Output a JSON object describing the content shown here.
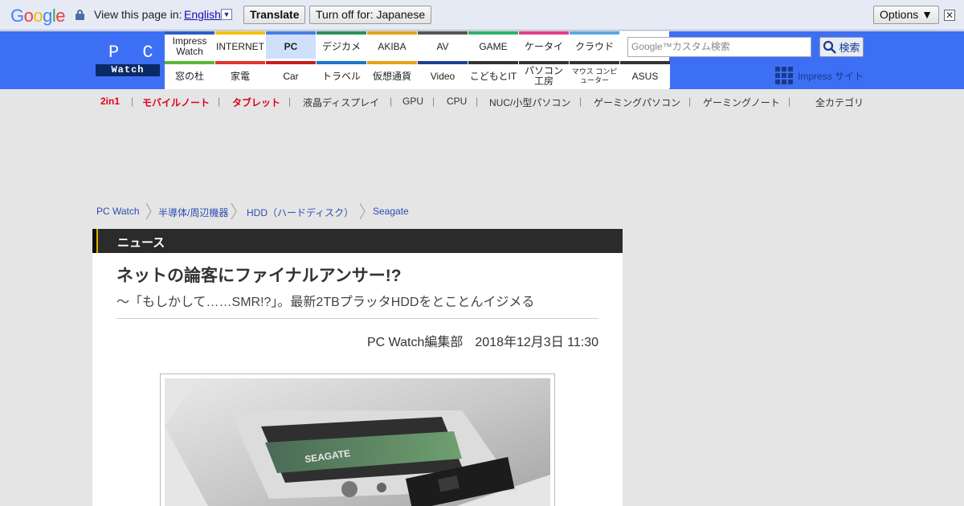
{
  "translate_bar": {
    "view_text": "View this page in:",
    "language": "English",
    "translate_label": "Translate",
    "turn_off_label": "Turn off for: Japanese",
    "options_label": "Options ▼",
    "close_symbol": "✕"
  },
  "header": {
    "logo_top": "P C",
    "logo_bottom": "Watch",
    "nav_top": [
      "Impress Watch",
      "INTERNET",
      "PC",
      "デジカメ",
      "AKIBA",
      "AV",
      "GAME",
      "ケータイ",
      "クラウド"
    ],
    "nav_bottom": [
      "窓の杜",
      "家電",
      "Car",
      "トラベル",
      "仮想通貨",
      "Video",
      "こどもとIT",
      "パソコン 工房",
      "マウス コンピューター",
      "ASUS"
    ],
    "nav_top_colors": [
      "#2a5fc8",
      "#f2c200",
      "#4a7be6",
      "#2a8f5a",
      "#e6a117",
      "#555555",
      "#2ab36a",
      "#e23c8c",
      "#58a8e8"
    ],
    "nav_bottom_colors": [
      "#5ab833",
      "#e0352b",
      "#c81e1e",
      "#1a77c9",
      "#e6a117",
      "#1f3f99",
      "#333333",
      "#333333",
      "#333333",
      "#333333"
    ],
    "search_placeholder": "Google™カスタム検索",
    "search_button": "検索",
    "impress_site": "Impress サイト"
  },
  "categories": [
    {
      "label": "2in1",
      "red": true
    },
    {
      "label": "モバイルノート",
      "red": true
    },
    {
      "label": "タブレット",
      "red": true
    },
    {
      "label": "液晶ディスプレイ",
      "red": false
    },
    {
      "label": "GPU",
      "red": false
    },
    {
      "label": "CPU",
      "red": false
    },
    {
      "label": "NUC/小型パソコン",
      "red": false
    },
    {
      "label": "ゲーミングパソコン",
      "red": false
    },
    {
      "label": "ゲーミングノート",
      "red": false
    }
  ],
  "all_categories": "全カテゴリ",
  "breadcrumb": [
    "PC Watch",
    "半導体/周辺機器",
    "HDD（ハードディスク）",
    "Seagate"
  ],
  "article": {
    "section": "ニュース",
    "title": "ネットの論客にファイナルアンサー!?",
    "subtitle": "～「もしかして……SMR!?」。最新2TBプラッタHDDをとことんイジメる",
    "author": "PC Watch編集部",
    "date": "2018年12月3日 11:30"
  }
}
